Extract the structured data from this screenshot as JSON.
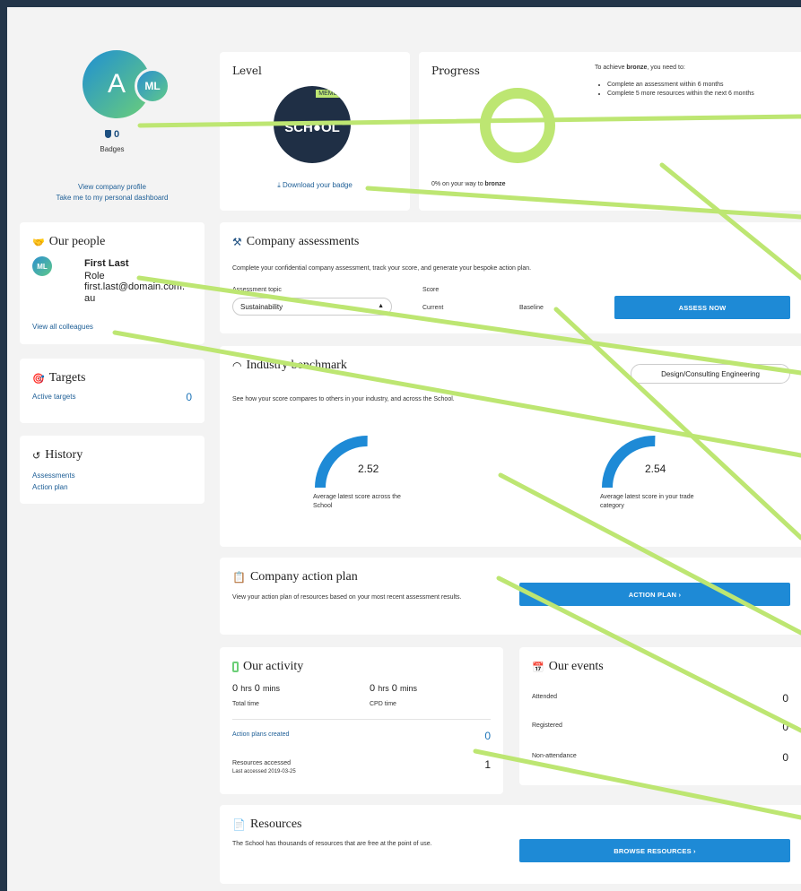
{
  "colors": {
    "accent": "#1e8ad6",
    "highlight": "#bde672",
    "navy": "#233549",
    "avatar_gradient": [
      "#1f8fd3",
      "#6ccf78"
    ]
  },
  "profile": {
    "avatar_letter": "A",
    "secondary_initials": "ML",
    "badge_count": "0",
    "badges_label": "Badges",
    "view_company_profile": "View company profile",
    "personal_dashboard": "Take me to my personal dashboard"
  },
  "level": {
    "title": "Level",
    "member_label": "MEMBER",
    "school_label": "SCH●OL",
    "download_label": "Download your badge"
  },
  "progress": {
    "title": "Progress",
    "percent": 0,
    "caption_prefix": "0% on your way to",
    "caption_target": "bronze",
    "intro_prefix": "To achieve",
    "intro_target": "bronze",
    "intro_suffix": ", you need to:",
    "items": [
      "Complete an assessment within 6 months",
      "Complete 5 more resources within the next 6 months"
    ]
  },
  "people": {
    "title": "Our people",
    "initials": "ML",
    "name": "First Last",
    "role": "Role",
    "email": "first.last@domain.com.au",
    "view_all": "View all colleagues"
  },
  "targets": {
    "title": "Targets",
    "active_label": "Active targets",
    "active_count": "0"
  },
  "history": {
    "title": "History",
    "links": [
      "Assessments",
      "Action plan"
    ]
  },
  "assessments": {
    "title": "Company assessments",
    "description": "Complete your confidential company assessment, track your score, and generate your bespoke action plan.",
    "topic_label": "Assessment topic",
    "topic_value": "Sustainability",
    "score_label": "Score",
    "current_label": "Current",
    "baseline_label": "Baseline",
    "button": "ASSESS NOW"
  },
  "benchmark": {
    "title": "Industry benchmark",
    "category": "Design/Consulting Engineering",
    "description": "See how your score compares to others in your industry, and across the School.",
    "gauges": [
      {
        "value": "2.52",
        "fraction": 0.504,
        "caption": "Average latest score across the School"
      },
      {
        "value": "2.54",
        "fraction": 0.508,
        "caption": "Average latest score in your trade category"
      }
    ]
  },
  "action_plan": {
    "title": "Company action plan",
    "description": "View your action plan of resources based on your most recent assessment results.",
    "button": "ACTION PLAN ›"
  },
  "activity": {
    "title": "Our activity",
    "total_hrs": "0",
    "total_mins": "0",
    "cpd_hrs": "0",
    "cpd_mins": "0",
    "hrs_unit": "hrs",
    "mins_unit": "mins",
    "total_label": "Total time",
    "cpd_label": "CPD time",
    "plans_label": "Action plans created",
    "plans_count": "0",
    "resources_label": "Resources accessed",
    "resources_count": "1",
    "last_accessed": "Last accessed 2019-03-25"
  },
  "events": {
    "title": "Our events",
    "rows": [
      {
        "label": "Attended",
        "count": "0"
      },
      {
        "label": "Registered",
        "count": "0"
      },
      {
        "label": "Non-attendance",
        "count": "0"
      }
    ]
  },
  "resources": {
    "title": "Resources",
    "description": "The School has thousands of resources that are free at the point of use.",
    "button": "BROWSE RESOURCES ›"
  }
}
